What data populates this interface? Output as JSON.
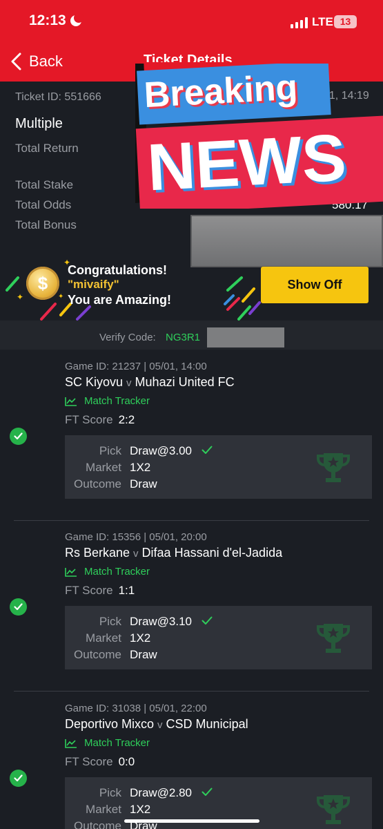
{
  "status_bar": {
    "time": "12:13",
    "network": "LTE",
    "battery": "13"
  },
  "nav": {
    "back_label": "Back",
    "title": "Ticket Details"
  },
  "ticket": {
    "id_label": "Ticket ID: 551666",
    "time_fragment": "01, 14:19",
    "type": "Multiple",
    "total_return_label": "Total Return",
    "total_stake_label": "Total Stake",
    "total_odds_label": "Total Odds",
    "total_odds_value": "580.17",
    "total_bonus_label": "Total Bonus"
  },
  "overlay": {
    "line1": "Breaking",
    "line2": "NEWS"
  },
  "congrats": {
    "line1": "Congratulations!",
    "username": "\"mivaify\"",
    "line3": "You are Amazing!",
    "button": "Show Off",
    "coin_symbol": "$"
  },
  "verify": {
    "label": "Verify Code:",
    "code": "NG3R1"
  },
  "labels": {
    "match_tracker": "Match Tracker",
    "ft_score": "FT Score",
    "pick": "Pick",
    "market": "Market",
    "outcome": "Outcome",
    "versus": "v"
  },
  "games": [
    {
      "game_id": "Game ID: 21237 | 05/01, 14:00",
      "home": "SC Kiyovu",
      "away": "Muhazi United FC",
      "score": "2:2",
      "pick": "Draw@3.00",
      "market": "1X2",
      "outcome": "Draw",
      "status": "won"
    },
    {
      "game_id": "Game ID: 15356 | 05/01, 20:00",
      "home": "Rs Berkane",
      "away": "Difaa Hassani d'el-Jadida",
      "score": "1:1",
      "pick": "Draw@3.10",
      "market": "1X2",
      "outcome": "Draw",
      "status": "won"
    },
    {
      "game_id": "Game ID: 31038 | 05/01, 22:00",
      "home": "Deportivo Mixco",
      "away": "CSD Municipal",
      "score": "0:0",
      "pick": "Draw@2.80",
      "market": "1X2",
      "outcome": "Draw",
      "status": "won"
    }
  ],
  "colors": {
    "header_red": "#e41827",
    "accent_green": "#2fcf5b",
    "button_yellow": "#f6c50f",
    "background": "#1b1e24"
  }
}
